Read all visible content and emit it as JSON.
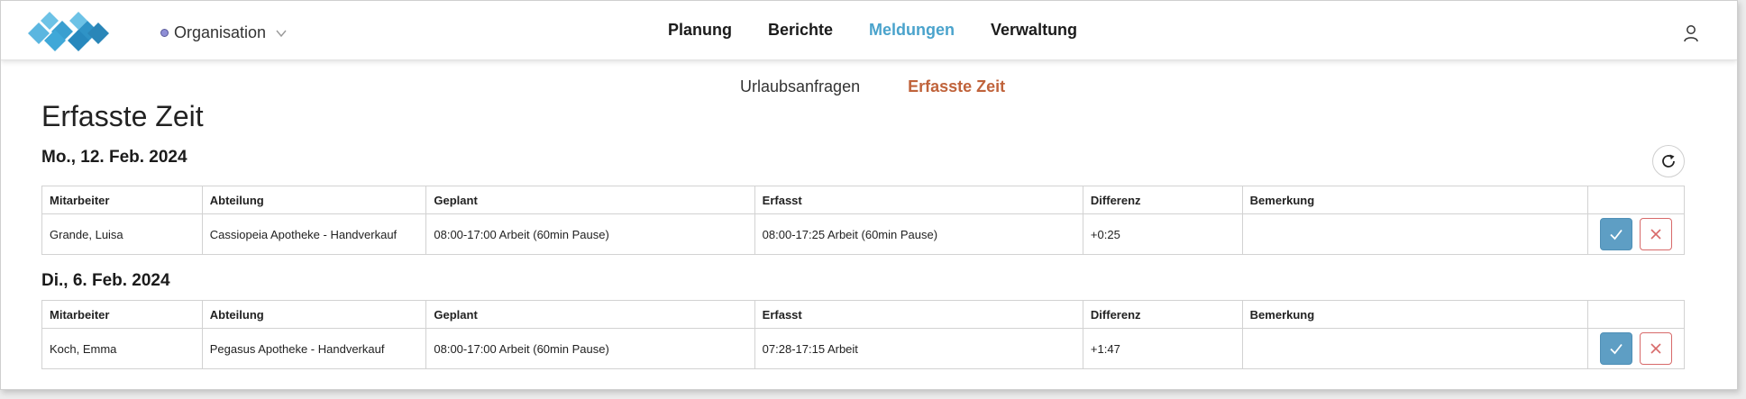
{
  "header": {
    "organisation_label": "Organisation",
    "nav": [
      "Planung",
      "Berichte",
      "Meldungen",
      "Verwaltung"
    ],
    "active_nav": "Meldungen"
  },
  "subtabs": {
    "items": [
      "Urlaubsanfragen",
      "Erfasste Zeit"
    ],
    "active": "Erfasste Zeit"
  },
  "page_title": "Erfasste Zeit",
  "columns": [
    "Mitarbeiter",
    "Abteilung",
    "Geplant",
    "Erfasst",
    "Differenz",
    "Bemerkung"
  ],
  "groups": [
    {
      "date": "Mo., 12. Feb. 2024",
      "rows": [
        {
          "employee": "Grande, Luisa",
          "department": "Cassiopeia Apotheke - Handverkauf",
          "planned": "08:00-17:00 Arbeit (60min Pause)",
          "recorded": "08:00-17:25 Arbeit (60min Pause)",
          "difference": "+0:25",
          "remark": ""
        }
      ]
    },
    {
      "date": "Di., 6. Feb. 2024",
      "rows": [
        {
          "employee": "Koch, Emma",
          "department": "Pegasus Apotheke - Handverkauf",
          "planned": "08:00-17:00 Arbeit (60min Pause)",
          "recorded": "07:28-17:15 Arbeit",
          "difference": "+1:47",
          "remark": ""
        }
      ]
    }
  ],
  "colors": {
    "nav_active": "#4aa3cc",
    "subtab_active": "#c0633b",
    "approve_button": "#5e9ec4",
    "reject_border": "#d86a6a"
  },
  "icons": {
    "logo": "diamond-logo-icon",
    "dropdown": "chevron-down-icon",
    "user": "user-icon",
    "refresh": "refresh-icon",
    "approve": "check-icon",
    "reject": "close-icon"
  }
}
